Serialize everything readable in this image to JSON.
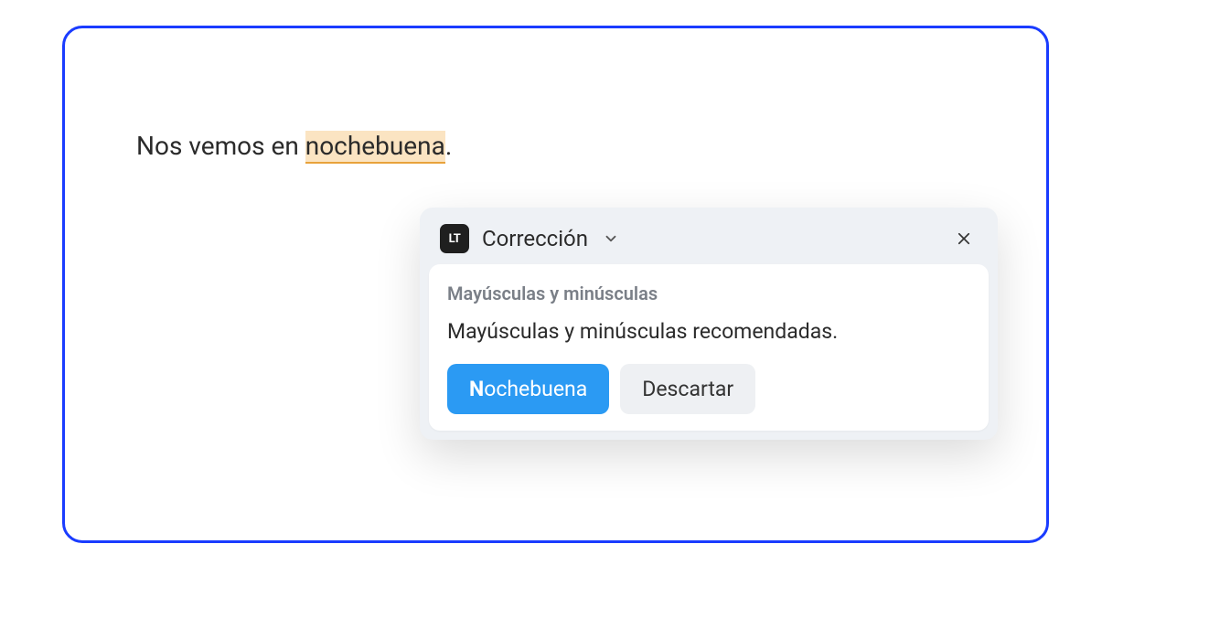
{
  "editor": {
    "text_before": "Nos vemos en ",
    "highlighted_word": "nochebuena",
    "text_after": "."
  },
  "popup": {
    "logo_label": "LT",
    "title": "Corrección",
    "category": "Mayúsculas y minúsculas",
    "description": "Mayúsculas y minúsculas recomendadas.",
    "suggestion_first_letter": "N",
    "suggestion_rest": "ochebuena",
    "dismiss_label": "Descartar"
  }
}
